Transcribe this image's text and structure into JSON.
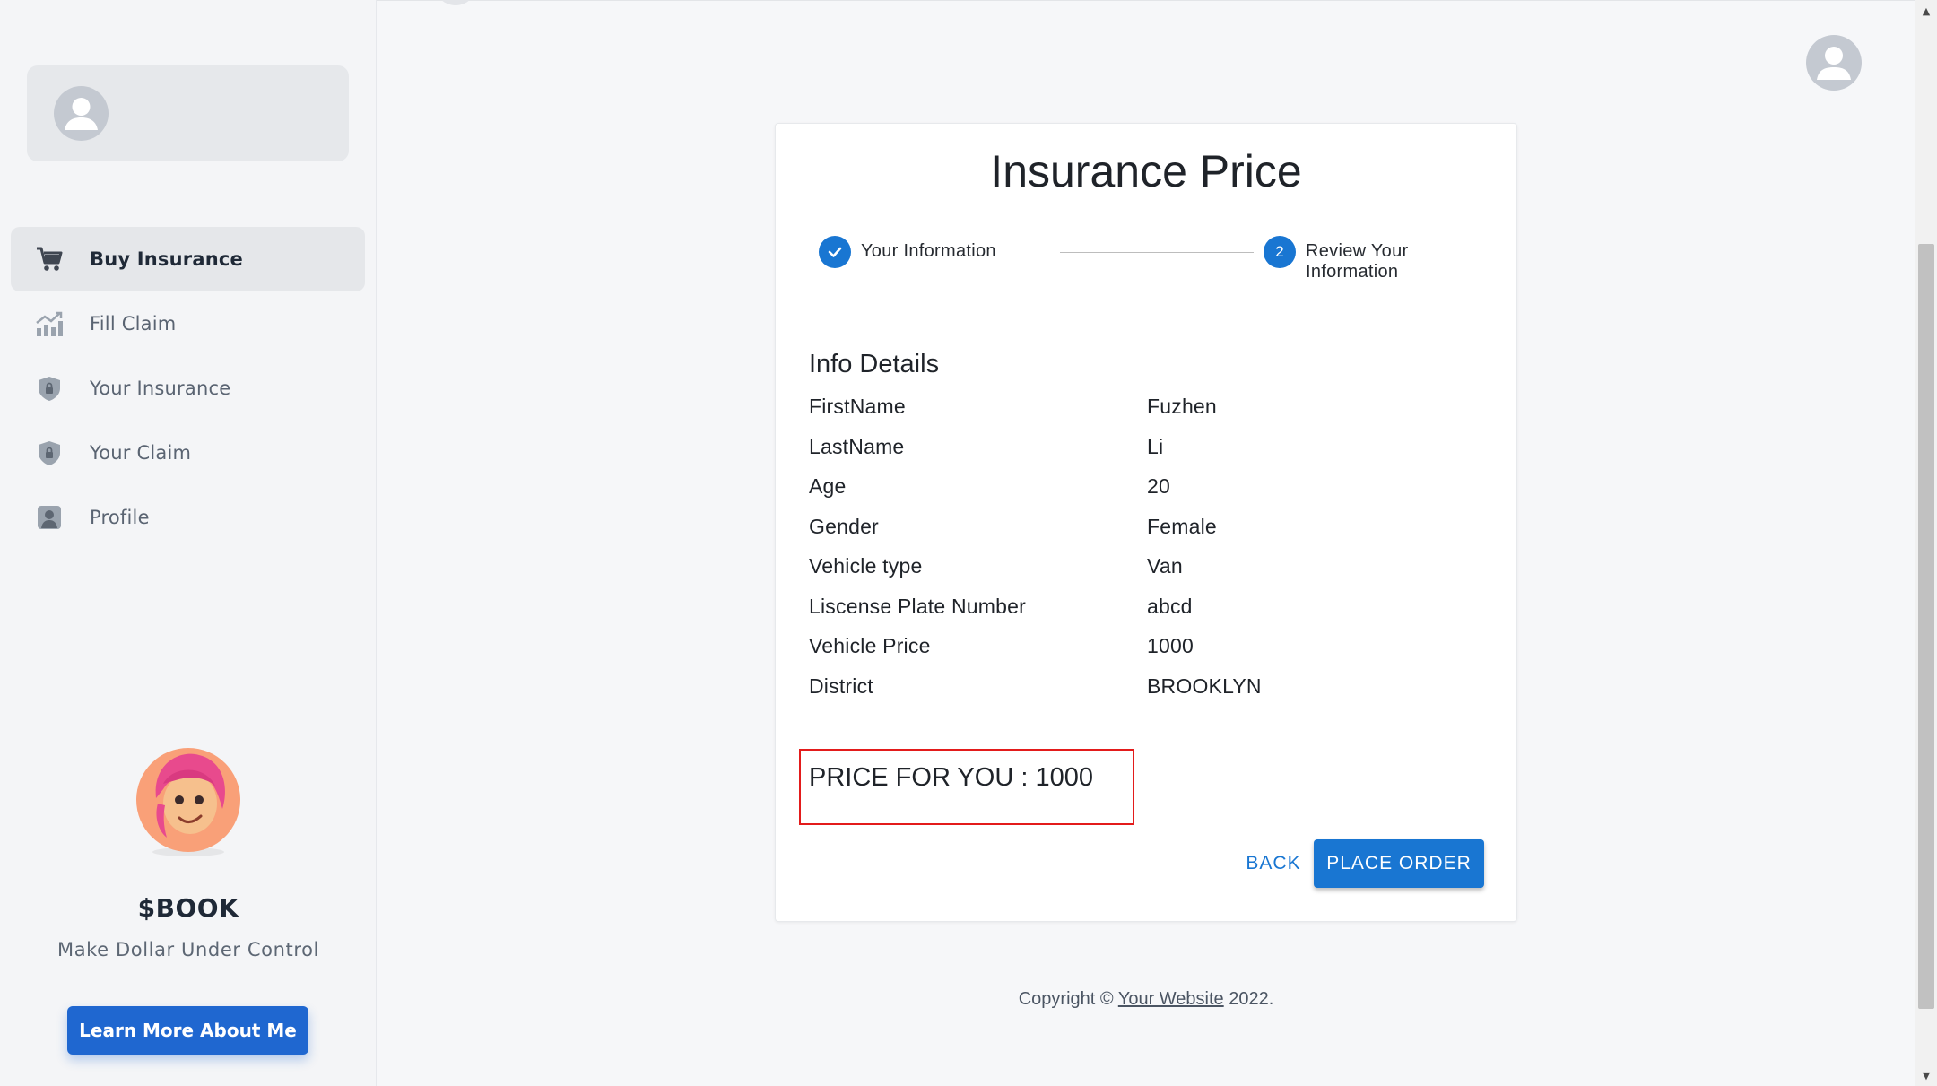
{
  "sidebar": {
    "nav": [
      {
        "label": "Buy Insurance",
        "icon": "cart-icon",
        "active": true
      },
      {
        "label": "Fill Claim",
        "icon": "chart-icon",
        "active": false
      },
      {
        "label": "Your Insurance",
        "icon": "shield-lock-icon",
        "active": false
      },
      {
        "label": "Your Claim",
        "icon": "shield-lock-icon",
        "active": false
      },
      {
        "label": "Profile",
        "icon": "profile-icon",
        "active": false
      }
    ],
    "promo": {
      "title": "$BOOK",
      "subtitle": "Make Dollar Under Control",
      "button_label": "Learn More About Me"
    }
  },
  "card": {
    "title": "Insurance Price",
    "steps": [
      {
        "label": "Your Information",
        "state": "completed",
        "number": "1"
      },
      {
        "label": "Review Your Information",
        "state": "active",
        "number": "2"
      }
    ],
    "info_heading": "Info Details",
    "info_rows": [
      {
        "key": "FirstName",
        "value": "Fuzhen"
      },
      {
        "key": "LastName",
        "value": "Li"
      },
      {
        "key": "Age",
        "value": "20"
      },
      {
        "key": "Gender",
        "value": "Female"
      },
      {
        "key": "Vehicle type",
        "value": "Van"
      },
      {
        "key": "Liscense Plate Number",
        "value": "abcd"
      },
      {
        "key": "Vehicle Price",
        "value": "1000"
      },
      {
        "key": "District",
        "value": "BROOKLYN"
      }
    ],
    "price_label": "PRICE FOR YOU : ",
    "price_value": "1000",
    "back_label": "BACK",
    "order_label": "PLACE ORDER"
  },
  "footer": {
    "prefix": "Copyright © ",
    "link": "Your Website",
    "suffix": " 2022."
  },
  "colors": {
    "primary": "#1976d2",
    "promo_button": "#1f67d0",
    "highlight_border": "#e31b1b"
  }
}
